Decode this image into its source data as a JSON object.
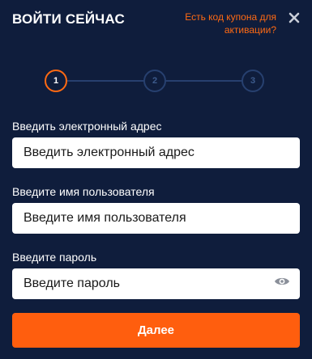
{
  "header": {
    "title": "ВОЙТИ СЕЙЧАС",
    "coupon_link": "Есть код купона для активации?",
    "close_icon": "close-icon"
  },
  "steps": {
    "items": [
      {
        "label": "1",
        "state": "active"
      },
      {
        "label": "2",
        "state": "inactive"
      },
      {
        "label": "3",
        "state": "inactive"
      }
    ],
    "active_color": "#ff6a13",
    "inactive_color": "#27406f"
  },
  "form": {
    "email_label": "Введить электронный адрес",
    "email_placeholder": "Введить электронный адрес",
    "username_label": "Введите имя пользователя",
    "username_placeholder": "Введите имя пользователя",
    "password_label": "Введите пароль",
    "password_placeholder": "Введите пароль",
    "password_toggle_icon": "eye-icon"
  },
  "submit": {
    "label": "Далее"
  },
  "colors": {
    "background": "#0f1d3c",
    "accent": "#ff5e0e"
  }
}
